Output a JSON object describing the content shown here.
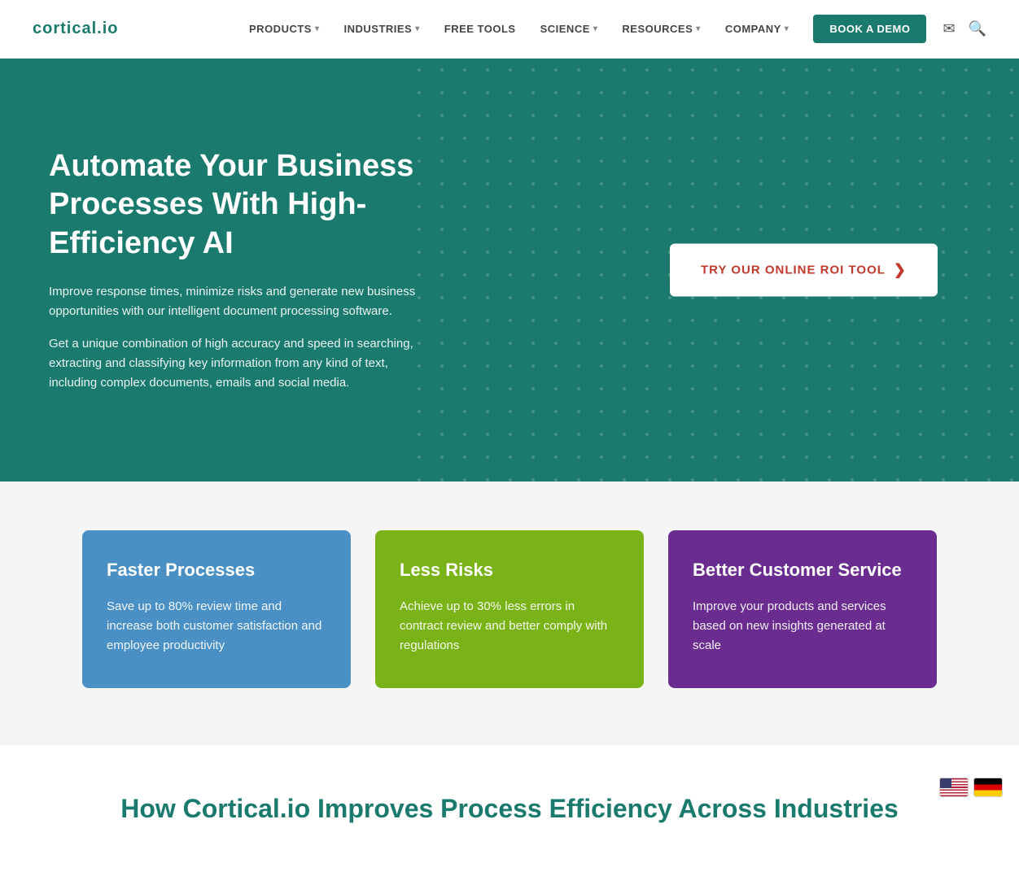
{
  "navbar": {
    "logo": "cortical.io",
    "nav_items": [
      {
        "label": "PRODUCTS",
        "has_dropdown": true
      },
      {
        "label": "INDUSTRIES",
        "has_dropdown": true
      },
      {
        "label": "FREE TOOLS",
        "has_dropdown": false
      },
      {
        "label": "SCIENCE",
        "has_dropdown": true
      },
      {
        "label": "RESOURCES",
        "has_dropdown": true
      },
      {
        "label": "COMPANY",
        "has_dropdown": true
      }
    ],
    "book_demo_label": "BOOK A DEMO"
  },
  "hero": {
    "title": "Automate Your Business Processes With High-Efficiency AI",
    "desc1": "Improve response times, minimize risks and generate new business opportunities with our intelligent document processing software.",
    "desc2": "Get a unique combination of high accuracy and speed in searching, extracting and classifying key information from any kind of text, including complex documents, emails and social media.",
    "roi_button_label": "TRY OUR ONLINE ROI TOOL"
  },
  "features": [
    {
      "id": "faster-processes",
      "title": "Faster Processes",
      "description": "Save up to 80% review time and increase both customer satisfaction and employee productivity",
      "color": "blue"
    },
    {
      "id": "less-risks",
      "title": "Less Risks",
      "description": "Achieve up to 30% less errors in contract review and better comply with regulations",
      "color": "green"
    },
    {
      "id": "better-customer-service",
      "title": "Better Customer Service",
      "description": "Improve your products and services based on new insights generated at scale",
      "color": "purple"
    }
  ],
  "bottom": {
    "title": "How Cortical.io Improves Process Efficiency Across Industries"
  },
  "flags": [
    {
      "code": "us",
      "label": "English"
    },
    {
      "code": "de",
      "label": "German"
    }
  ]
}
